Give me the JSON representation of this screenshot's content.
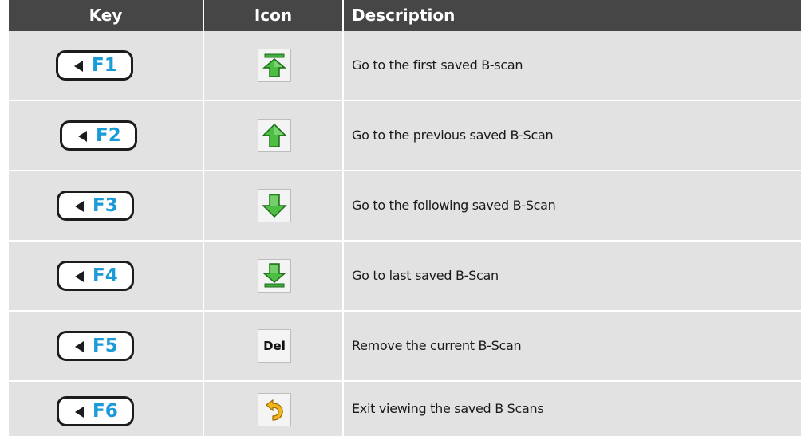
{
  "header": {
    "key": "Key",
    "icon": "Icon",
    "description": "Description"
  },
  "rows": [
    {
      "key": "F1",
      "icon": "first-scan-icon",
      "description": "Go to the first saved B-scan"
    },
    {
      "key": "F2",
      "icon": "previous-scan-icon",
      "description": "Go to the previous saved B-Scan"
    },
    {
      "key": "F3",
      "icon": "next-scan-icon",
      "description": "Go to the following saved B-Scan"
    },
    {
      "key": "F4",
      "icon": "last-scan-icon",
      "description": "Go to last saved B-Scan"
    },
    {
      "key": "F5",
      "icon": "delete-icon",
      "icon_label": "Del",
      "description": "Remove the current B-Scan"
    },
    {
      "key": "F6",
      "icon": "exit-icon",
      "description": "Exit viewing the saved B Scans"
    }
  ],
  "colors": {
    "header_bg": "#464646",
    "row_bg": "#e2e2e2",
    "key_label": "#1a9ad6",
    "arrow_green": "#3fae3a",
    "exit_yellow": "#f2b51c"
  }
}
